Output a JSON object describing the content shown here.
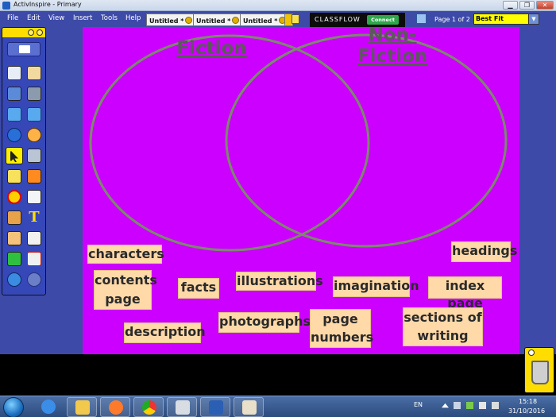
{
  "window": {
    "title": "ActivInspire - Primary",
    "controls": {
      "minimize": "▁",
      "maximize": "❐",
      "close": "✕"
    }
  },
  "menu": {
    "items": [
      "File",
      "Edit",
      "View",
      "Insert",
      "Tools",
      "Help"
    ]
  },
  "tabs": [
    {
      "label": "Untitled *"
    },
    {
      "label": "Untitled *"
    },
    {
      "label": "Untitled *"
    }
  ],
  "classflow": {
    "label": "CLASSFLOW",
    "connect": "Connect"
  },
  "pager": {
    "label": "Page 1 of 2"
  },
  "zoom": {
    "value": "Best Fit",
    "arrow": "▼"
  },
  "flipchart": {
    "titles": {
      "left": "Fiction",
      "right": "Non-\nFiction"
    },
    "cards": [
      "characters",
      "headings",
      "contents\npage",
      "facts",
      "illustrations",
      "imagination",
      "index page",
      "description",
      "photographs",
      "page\nnumbers",
      "sections of\nwriting"
    ],
    "colors": {
      "background": "#cc00ff",
      "circle_stroke": "#7a8a6a",
      "card": "#ffd9a8"
    }
  },
  "trash": {
    "icon": "trash-can-icon"
  },
  "taskbar": {
    "language": "EN",
    "time": "15:18",
    "date": "31/10/2016",
    "apps": [
      "ie-icon",
      "explorer-icon",
      "media-player-icon",
      "chrome-icon",
      "activinspire-icon",
      "word-icon",
      "paint-icon"
    ]
  }
}
